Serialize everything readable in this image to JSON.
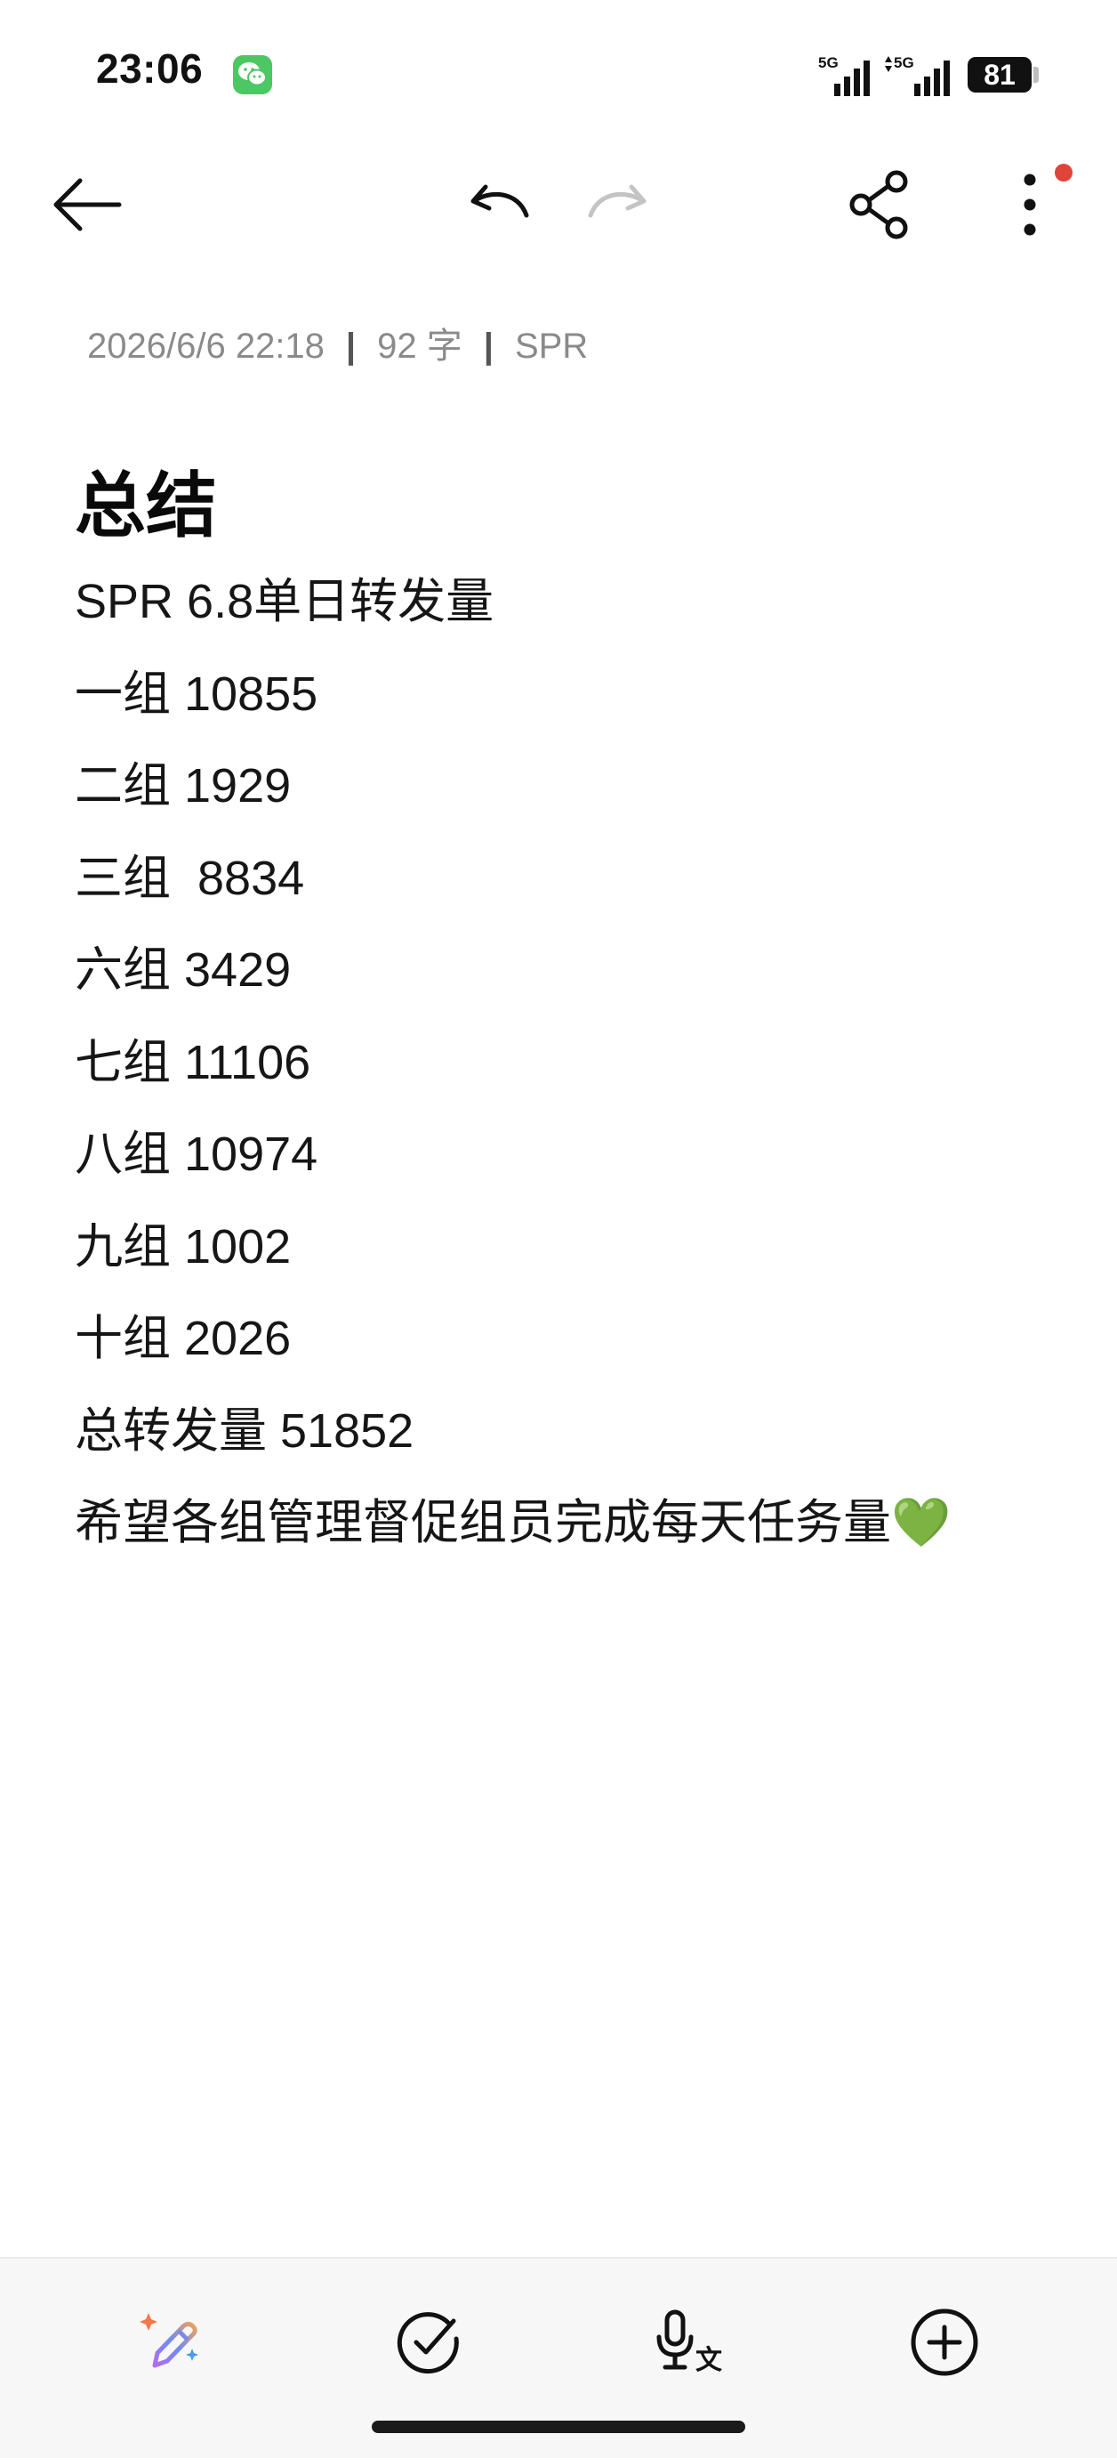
{
  "status_bar": {
    "time": "23:06",
    "notification_app_icon": "wechat-icon",
    "signal_1_label": "5G",
    "signal_2_label": "5G",
    "battery_level": "81"
  },
  "toolbar": {
    "back_icon": "arrow-left-icon",
    "undo_icon": "undo-icon",
    "redo_icon": "redo-icon",
    "redo_enabled": false,
    "share_icon": "share-icon",
    "more_icon": "more-vertical-icon",
    "more_has_notification_dot": true
  },
  "meta": {
    "datetime": "2026/6/6 22:18",
    "word_count": "92 字",
    "folder": "SPR"
  },
  "note": {
    "title": "总结",
    "lines": [
      "SPR 6.8单日转发量",
      "一组 10855",
      "二组 1929",
      "三组  8834",
      "六组 3429",
      "七组 11106",
      "八组 10974",
      "九组 1002",
      "十组 2026",
      "总转发量 51852",
      "希望各组管理督促组员完成每天任务量💚"
    ]
  },
  "bottom_bar": {
    "items": [
      {
        "icon": "ai-pen-sparkle-icon"
      },
      {
        "icon": "checklist-icon"
      },
      {
        "icon": "voice-transcribe-icon"
      },
      {
        "icon": "add-circle-icon"
      }
    ]
  },
  "colors": {
    "background": "#ffffff",
    "text": "#161616",
    "meta_text": "#8a8a8a",
    "notification_dot": "#e0433a",
    "wechat_green": "#4cc763",
    "bottom_bar_bg": "#f7f7f7"
  }
}
